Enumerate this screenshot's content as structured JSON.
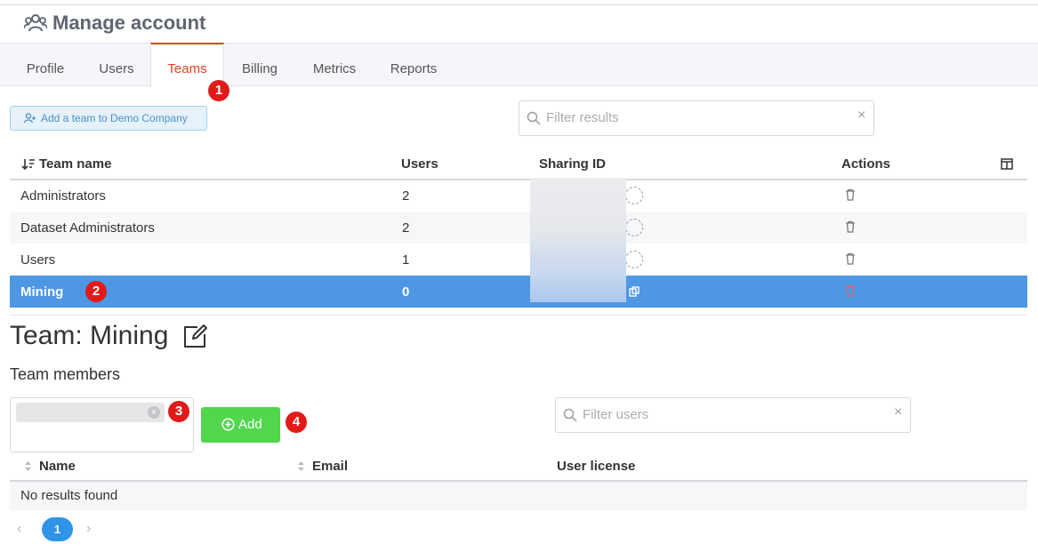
{
  "header": {
    "title": "Manage account",
    "icon": "users-icon"
  },
  "tabs": [
    {
      "label": "Profile",
      "active": false
    },
    {
      "label": "Users",
      "active": false
    },
    {
      "label": "Teams",
      "active": true
    },
    {
      "label": "Billing",
      "active": false
    },
    {
      "label": "Metrics",
      "active": false
    },
    {
      "label": "Reports",
      "active": false
    }
  ],
  "annotations": [
    "1",
    "2",
    "3",
    "4"
  ],
  "toolbar": {
    "add_team_label": "Add a team to Demo Company",
    "filter_placeholder": "Filter results",
    "clear_symbol": "×"
  },
  "teams_table": {
    "columns": [
      "Team name",
      "Users",
      "Sharing ID",
      "Actions"
    ],
    "rows": [
      {
        "name": "Administrators",
        "users": "2",
        "selected": false
      },
      {
        "name": "Dataset Administrators",
        "users": "2",
        "selected": false
      },
      {
        "name": "Users",
        "users": "1",
        "selected": false
      },
      {
        "name": "Mining",
        "users": "0",
        "selected": true
      }
    ]
  },
  "team_detail": {
    "heading": "Team: Mining",
    "members_label": "Team members",
    "add_button": "Add",
    "filter_users_placeholder": "Filter users",
    "clear_symbol": "×",
    "members_columns": [
      "Name",
      "Email",
      "User license"
    ],
    "empty_text": "No results found"
  },
  "pagination": {
    "prev": "‹",
    "current_page": "1",
    "next": "›"
  },
  "colors": {
    "accent_active_tab": "#e8401c",
    "selected_row": "#4d97e3",
    "add_button": "#52d64e",
    "annotation_badge": "#e21a1a",
    "page_pill": "#2f93e8"
  }
}
